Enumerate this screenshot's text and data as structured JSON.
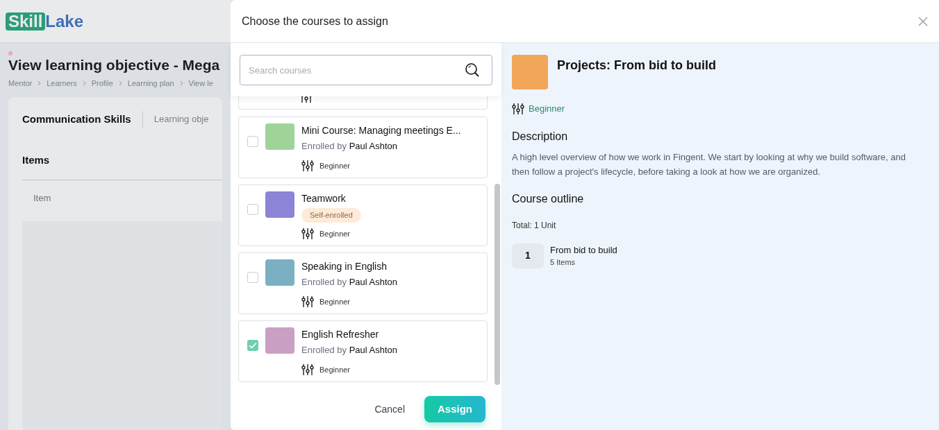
{
  "background": {
    "logo": {
      "part1": "Skill",
      "part2": "Lake"
    },
    "title": "View learning objective - Mega",
    "breadcrumb": [
      "Mentor",
      "Learners",
      "Profile",
      "Learning plan",
      "View le"
    ],
    "card": {
      "heading": "Communication Skills",
      "tab": "Learning obje",
      "section": "Items",
      "column": "Item"
    }
  },
  "modal": {
    "title": "Choose the courses to assign",
    "search": {
      "placeholder": "Search courses"
    },
    "courses": [
      {
        "kind": "enrolled",
        "title": "Mini Course: Managing meetings E...",
        "enrolled_label": "Enrolled by",
        "enrolled_by": "Paul Ashton",
        "level": "Beginner",
        "checked": false
      },
      {
        "kind": "self",
        "title": "Teamwork",
        "badge": "Self-enrolled",
        "level": "Beginner",
        "checked": false
      },
      {
        "kind": "enrolled",
        "title": "Speaking in English",
        "enrolled_label": "Enrolled by",
        "enrolled_by": "Paul Ashton",
        "level": "Beginner",
        "checked": false
      },
      {
        "kind": "enrolled",
        "title": "English Refresher",
        "enrolled_label": "Enrolled by",
        "enrolled_by": "Paul Ashton",
        "level": "Beginner",
        "checked": true
      }
    ],
    "buttons": {
      "cancel": "Cancel",
      "assign": "Assign"
    },
    "detail": {
      "title": "Projects: From bid to build",
      "level": "Beginner",
      "description_heading": "Description",
      "description": "A high level overview of how we work in Fingent. We start by looking at why we build software, and then follow a project's lifecycle, before taking a look at how we are organized.",
      "outline_heading": "Course outline",
      "total": "Total: 1 Unit",
      "units": [
        {
          "number": "1",
          "title": "From bid to build",
          "items": "5 Items"
        }
      ]
    }
  }
}
